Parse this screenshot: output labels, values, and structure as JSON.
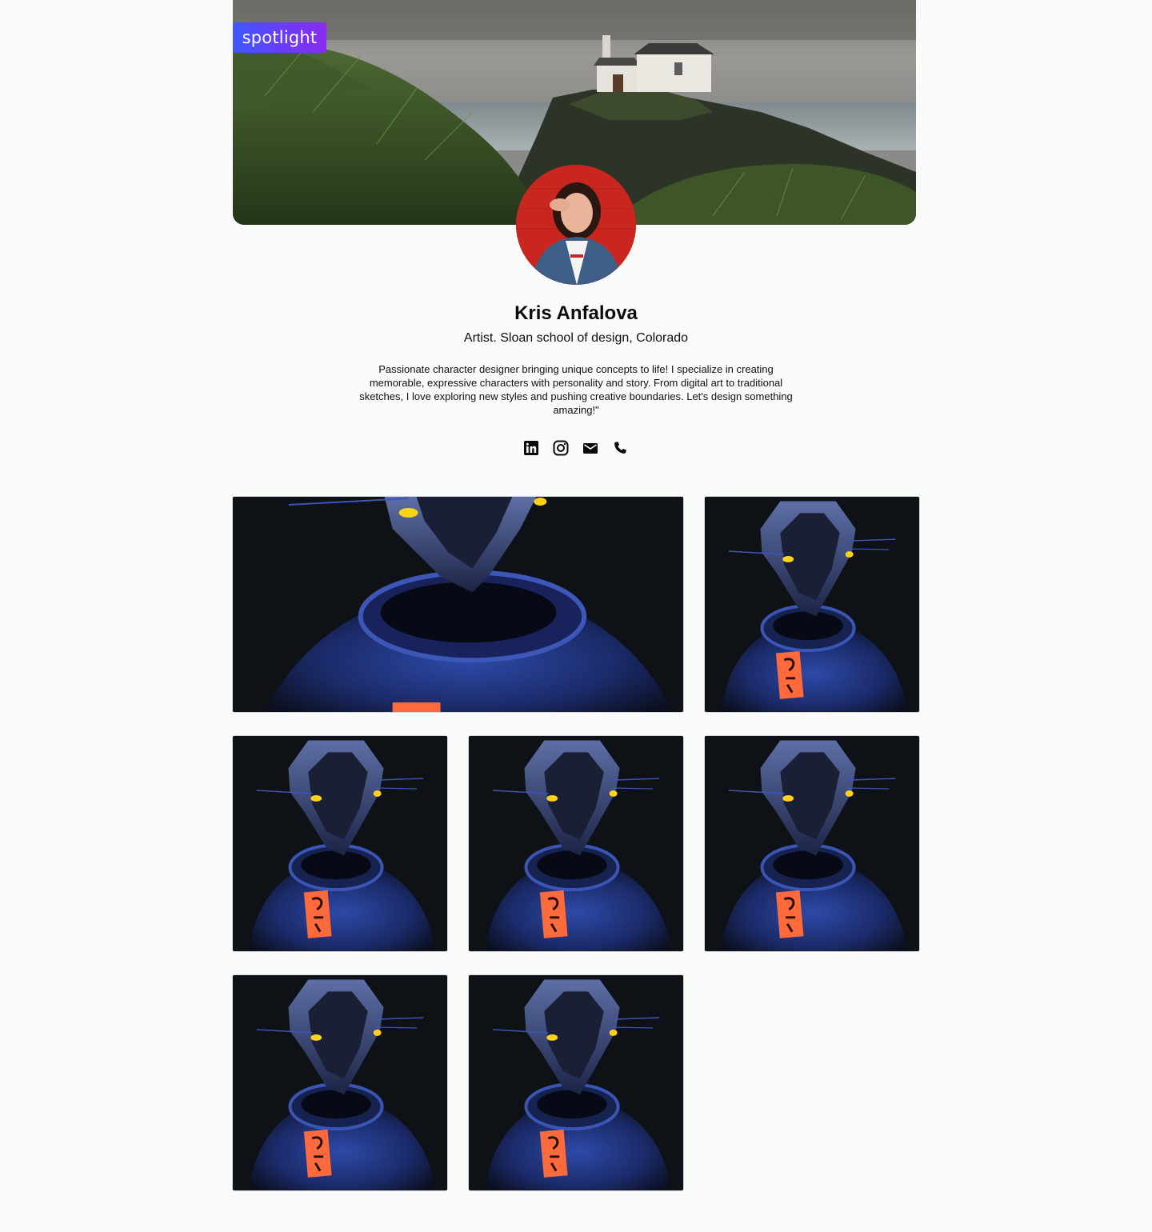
{
  "brand": {
    "logo_text": "spotlight"
  },
  "profile": {
    "name": "Kris Anfalova",
    "subtitle": "Artist. Sloan school of design, Colorado",
    "bio": "Passionate character designer bringing unique concepts to life! I specialize in creating memorable, expressive characters with personality and story. From digital art to traditional sketches, I love exploring new styles and pushing creative boundaries. Let's design something amazing!\""
  },
  "socials": [
    {
      "icon": "linkedin-icon"
    },
    {
      "icon": "instagram-icon"
    },
    {
      "icon": "email-icon"
    },
    {
      "icon": "phone-icon"
    }
  ],
  "colors": {
    "background": "#f9fafa",
    "brand_gradient_start": "#3f57ff",
    "brand_gradient_end": "#8a2cf0",
    "tile_background": "#0e1116"
  },
  "gallery": {
    "count": 7
  }
}
